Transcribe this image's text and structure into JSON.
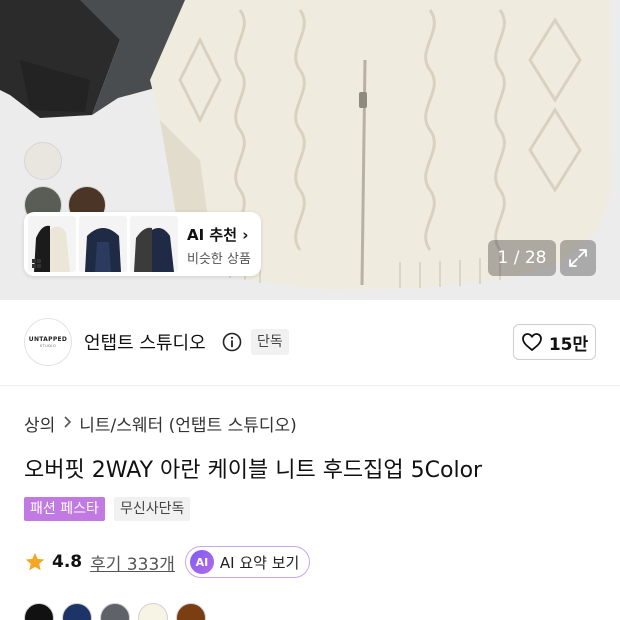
{
  "hero": {
    "thumb_colors": [
      "#e8e6df",
      "#5a5d56",
      "#4a3526"
    ],
    "ai_card": {
      "title": "AI 추천 ›",
      "subtitle": "비슷한 상품",
      "thumbs": [
        "black-white-hoodie",
        "navy-hoodie",
        "charcoal-navy-hoodie"
      ]
    },
    "counter": "1 / 28"
  },
  "brand": {
    "logo_line1": "UNTAPPED",
    "logo_line2": "STUDIO",
    "name": "언탭트 스튜디오",
    "exclusive_tag": "단독",
    "likes": "15만"
  },
  "product": {
    "breadcrumb": [
      "상의",
      "니트/스웨터 (언탭트 스튜디오)"
    ],
    "title": "오버핏 2WAY 아란 케이블 니트 후드집업 5Color",
    "tags": [
      "패션 페스타",
      "무신사단독"
    ],
    "rating": "4.8",
    "review_link": "후기 333개",
    "ai_summary_badge": "AI",
    "ai_summary_label": "AI 요약 보기",
    "colors": [
      "#111111",
      "#1d3566",
      "#5f6268",
      "#f7f4e6",
      "#7a3e12"
    ]
  },
  "accent": {
    "fashion_festa": "#c07ae2",
    "ai_border": "#c7a6f0",
    "star": "#f5a623"
  }
}
